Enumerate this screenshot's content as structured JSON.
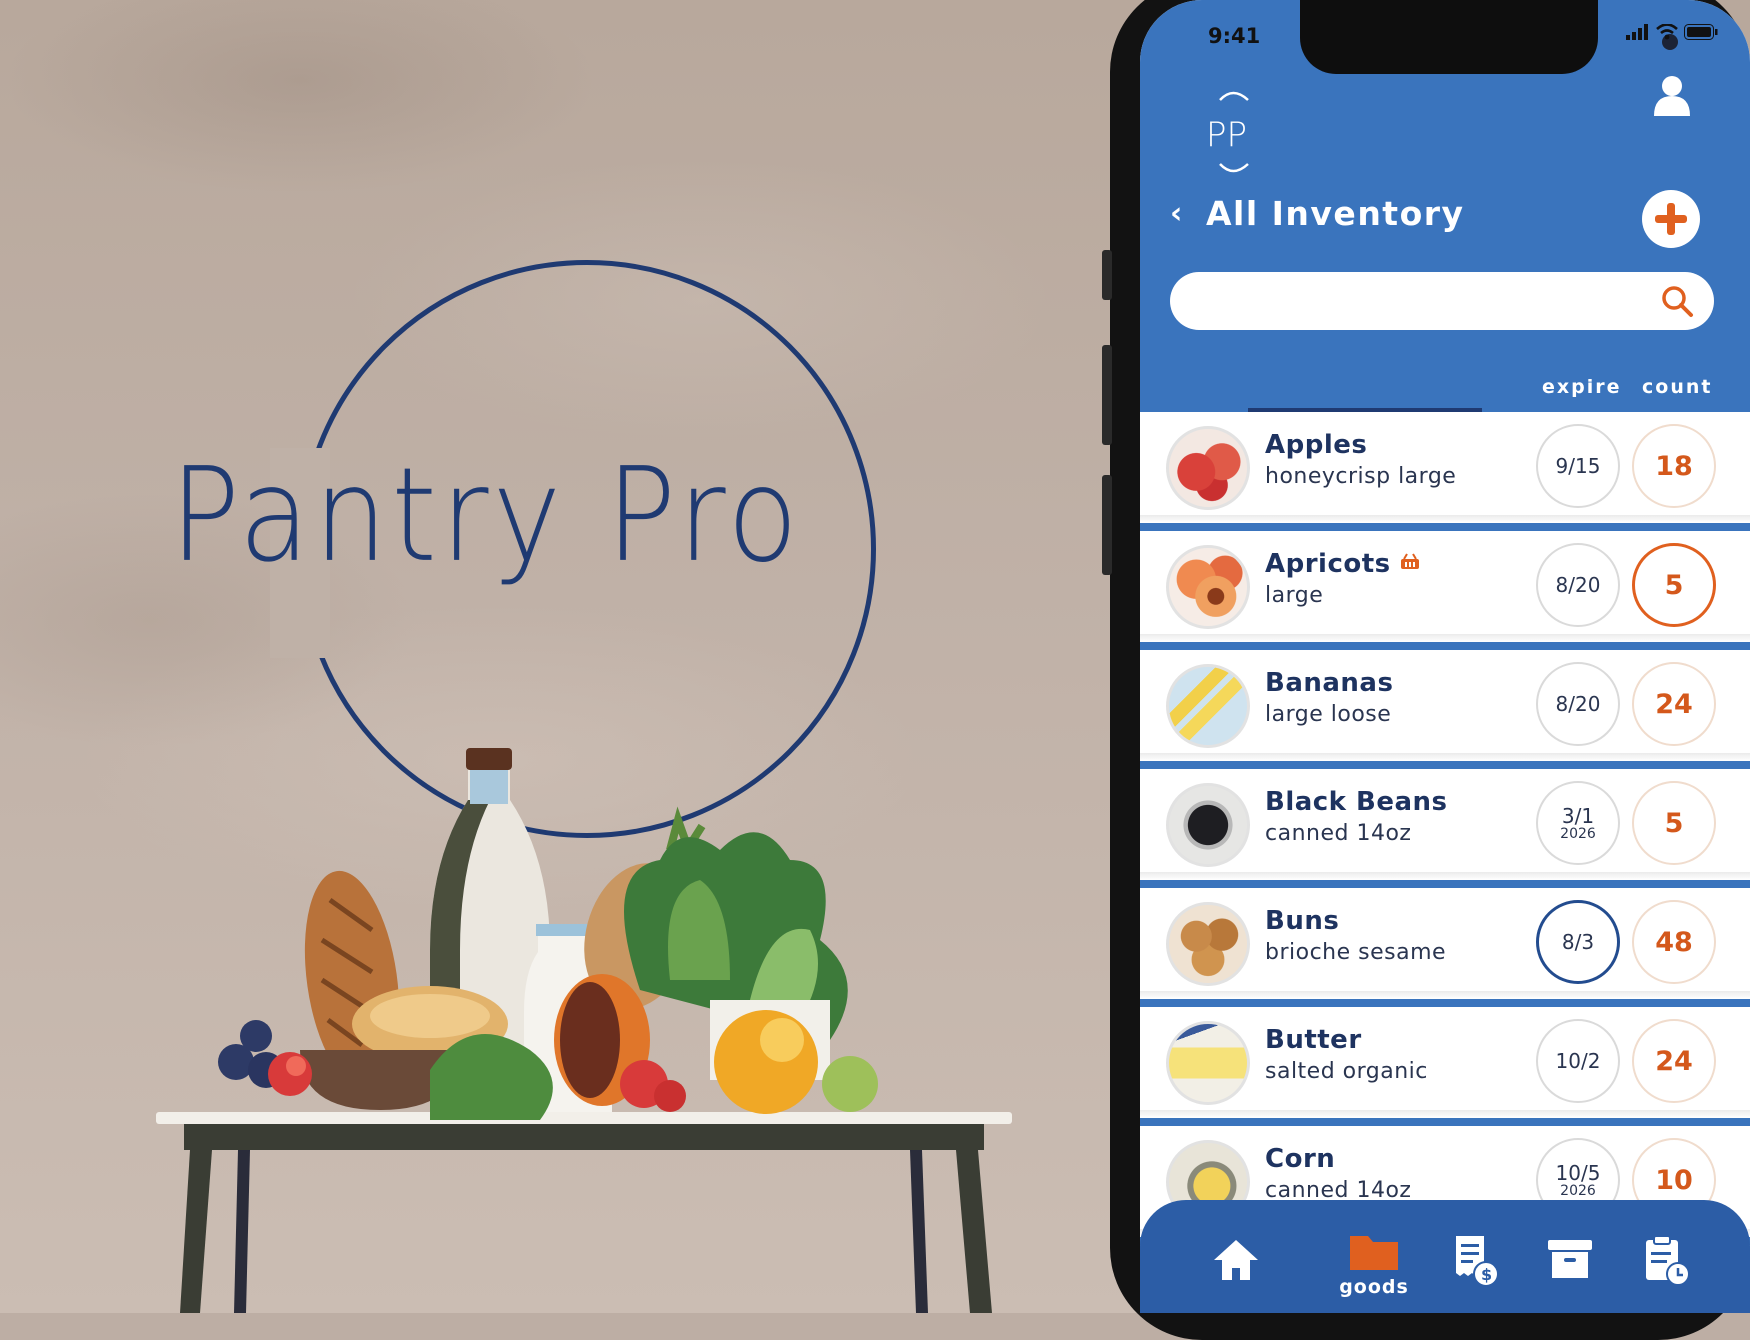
{
  "brand": {
    "logo_text": "Pantry Pro",
    "app_monogram": "PP",
    "accent": "#3a74bd",
    "navy": "#1f3a72",
    "orange": "#e0601f"
  },
  "status_bar": {
    "time": "9:41"
  },
  "header": {
    "back_symbol": "‹",
    "title": "All Inventory",
    "add_icon": "plus-icon",
    "profile_icon": "user-icon"
  },
  "search": {
    "placeholder": "",
    "value": "",
    "icon": "search-icon"
  },
  "columns": {
    "expire": "expire",
    "count": "count"
  },
  "items": [
    {
      "name": "Apples",
      "desc": "honeycrisp large",
      "expire": "9/15",
      "expire_year": "",
      "count": "18",
      "thumb": "apple",
      "badge": ""
    },
    {
      "name": "Apricots",
      "desc": "large",
      "expire": "8/20",
      "expire_year": "",
      "count": "5",
      "thumb": "apricot",
      "badge": "basket-icon",
      "count_selected": true
    },
    {
      "name": "Bananas",
      "desc": "large loose",
      "expire": "8/20",
      "expire_year": "",
      "count": "24",
      "thumb": "banana",
      "badge": ""
    },
    {
      "name": "Black Beans",
      "desc": "canned 14oz",
      "expire": "3/1",
      "expire_year": "2026",
      "count": "5",
      "thumb": "beans",
      "badge": ""
    },
    {
      "name": "Buns",
      "desc": "brioche sesame",
      "expire": "8/3",
      "expire_year": "",
      "count": "48",
      "thumb": "buns",
      "badge": "",
      "expire_selected": true
    },
    {
      "name": "Butter",
      "desc": "salted organic",
      "expire": "10/2",
      "expire_year": "",
      "count": "24",
      "thumb": "butter",
      "badge": ""
    },
    {
      "name": "Corn",
      "desc": "canned 14oz",
      "expire": "10/5",
      "expire_year": "2026",
      "count": "10",
      "thumb": "corn",
      "badge": ""
    }
  ],
  "tabbar": {
    "active_label": "goods",
    "tabs": [
      {
        "icon": "home-icon"
      },
      {
        "icon": "folder-icon",
        "label": "goods",
        "active": true
      },
      {
        "icon": "receipt-dollar-icon"
      },
      {
        "icon": "archive-box-icon"
      },
      {
        "icon": "clipboard-clock-icon"
      }
    ]
  }
}
